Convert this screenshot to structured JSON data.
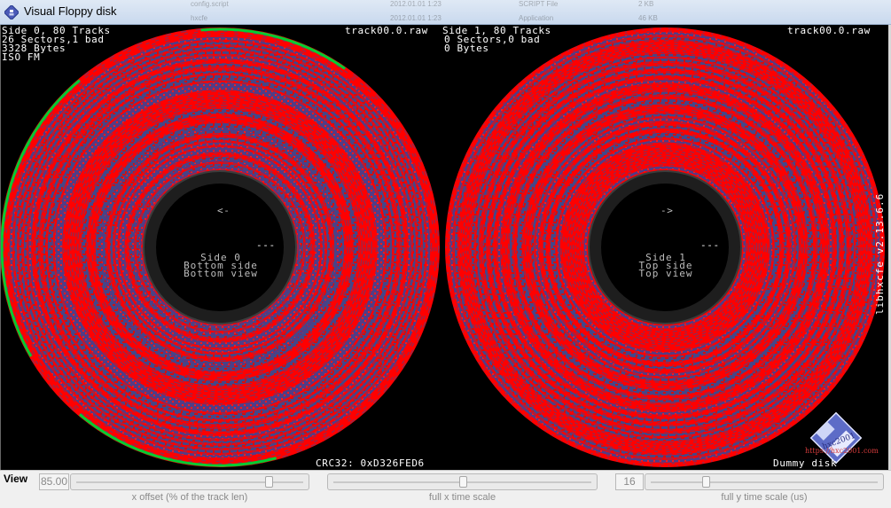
{
  "window": {
    "title": "Visual Floppy disk",
    "icon": "floppy-app-icon"
  },
  "background_window": {
    "rows": [
      {
        "name": "config.script",
        "date": "2012.01.01 1:23",
        "type": "SCRIPT File",
        "size": "2 KB"
      },
      {
        "name": "hxcfe",
        "date": "2012.01.01 1:23",
        "type": "Application",
        "size": "46 KB"
      }
    ]
  },
  "side0": {
    "line1": "Side 0, 80 Tracks",
    "line2": "26 Sectors,1 bad",
    "line3": "3328 Bytes",
    "line4": "ISO FM",
    "file": "track00.0.raw",
    "arrow": "<-",
    "hub_dash": "---",
    "hub_line1": "Side 0",
    "hub_line2": "Bottom side",
    "hub_line3": "Bottom view"
  },
  "side1": {
    "line1": "Side 1, 80 Tracks",
    "line2": "0 Sectors,0 bad",
    "line3": "0 Bytes",
    "file": "track00.0.raw",
    "arrow": "->",
    "hub_dash": "---",
    "hub_line1": "Side 1",
    "hub_line2": "Top side",
    "hub_line3": "Top view"
  },
  "crc": "CRC32: 0xD326FED6",
  "disk_name": "Dummy disk",
  "version": "libhxcfe v2.13.6.6",
  "logo_text": "hxc2001",
  "url": "https://hxc2001.com",
  "colors": {
    "background": "#000000",
    "sector_ok": "#ff0000",
    "track_data": "#3b4a8f",
    "good_marker": "#00cc33",
    "hub": "#2a2a2a"
  },
  "controls": {
    "view_label": "View",
    "x_offset": {
      "value": "85.00",
      "caption": "x offset (% of the track len)",
      "level": 0.85
    },
    "x_time_scale": {
      "caption": "full x time scale",
      "level": 0.5
    },
    "y_time_scale": {
      "value": "16",
      "caption": "full y time scale (us)",
      "level": 0.24
    }
  }
}
